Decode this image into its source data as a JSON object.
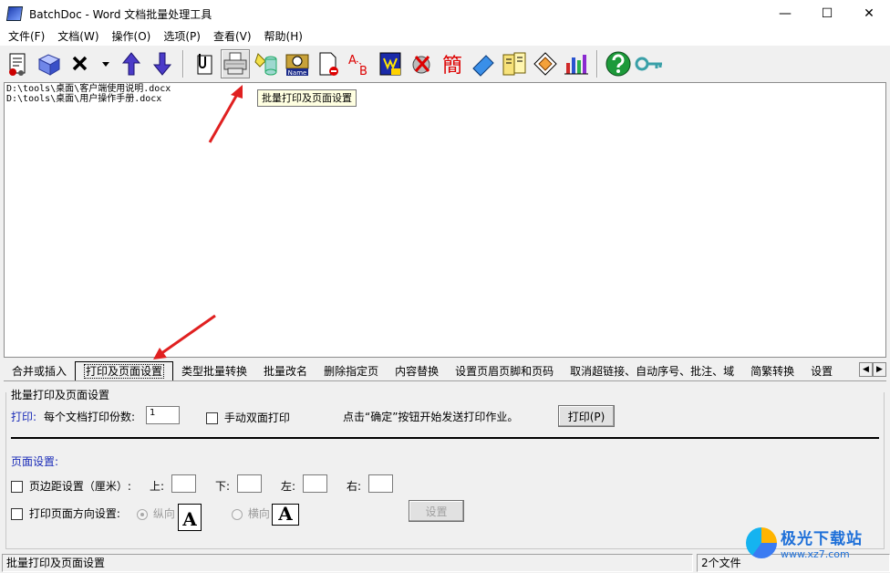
{
  "window": {
    "title": "BatchDoc - Word 文档批量处理工具",
    "minimize": "—",
    "maximize": "☐",
    "close": "✕"
  },
  "menu": [
    "文件(F)",
    "文档(W)",
    "操作(O)",
    "选项(P)",
    "查看(V)",
    "帮助(H)"
  ],
  "toolbar": {
    "buttons": [
      "add-file-icon",
      "add-folder-icon",
      "remove-icon",
      "dropdown-icon",
      "move-up-icon",
      "move-down-icon",
      "clip-icon",
      "printer-icon",
      "convert-icon",
      "rename-icon",
      "delete-page-icon",
      "replace-icon",
      "header-footer-icon",
      "unlink-icon",
      "simplified-icon",
      "merge-icon",
      "settings-icon",
      "style-icon",
      "chart-icon",
      "help-icon",
      "register-icon"
    ],
    "simplified_glyph": "簡",
    "name_badge": "Name",
    "replace_a": "A",
    "replace_b": "B"
  },
  "files": [
    "D:\\tools\\桌面\\客户端使用说明.docx",
    "D:\\tools\\桌面\\用户操作手册.docx"
  ],
  "tooltip": "批量打印及页面设置",
  "tabs": [
    "合并或插入",
    "打印及页面设置",
    "类型批量转换",
    "批量改名",
    "删除指定页",
    "内容替换",
    "设置页眉页脚和页码",
    "取消超链接、自动序号、批注、域",
    "简繁转换",
    "设置"
  ],
  "tab_scroll": {
    "left": "◀",
    "right": "▶"
  },
  "active_tab": 1,
  "panel": {
    "group_title": "批量打印及页面设置",
    "print_label": "打印:",
    "copies_label": "每个文档打印份数:",
    "copies_value": "1",
    "duplex_label": "手动双面打印",
    "hint": "点击“确定”按钮开始发送打印作业。",
    "print_button": "打印(P)",
    "page_setup_label": "页面设置:",
    "margin_label": "页边距设置（厘米）:",
    "top_label": "上:",
    "bottom_label": "下:",
    "left_label": "左:",
    "right_label": "右:",
    "orientation_label": "打印页面方向设置:",
    "portrait_label": "纵向",
    "landscape_label": "横向",
    "orient_glyph": "A",
    "set_button": "设置"
  },
  "status": {
    "left": "批量打印及页面设置",
    "right": "2个文件"
  },
  "watermark": {
    "title": "极光下载站",
    "url": "www.xz7.com"
  },
  "colors": {
    "accent_blue": "#1a2bb8",
    "arrow_red": "#e02020"
  }
}
